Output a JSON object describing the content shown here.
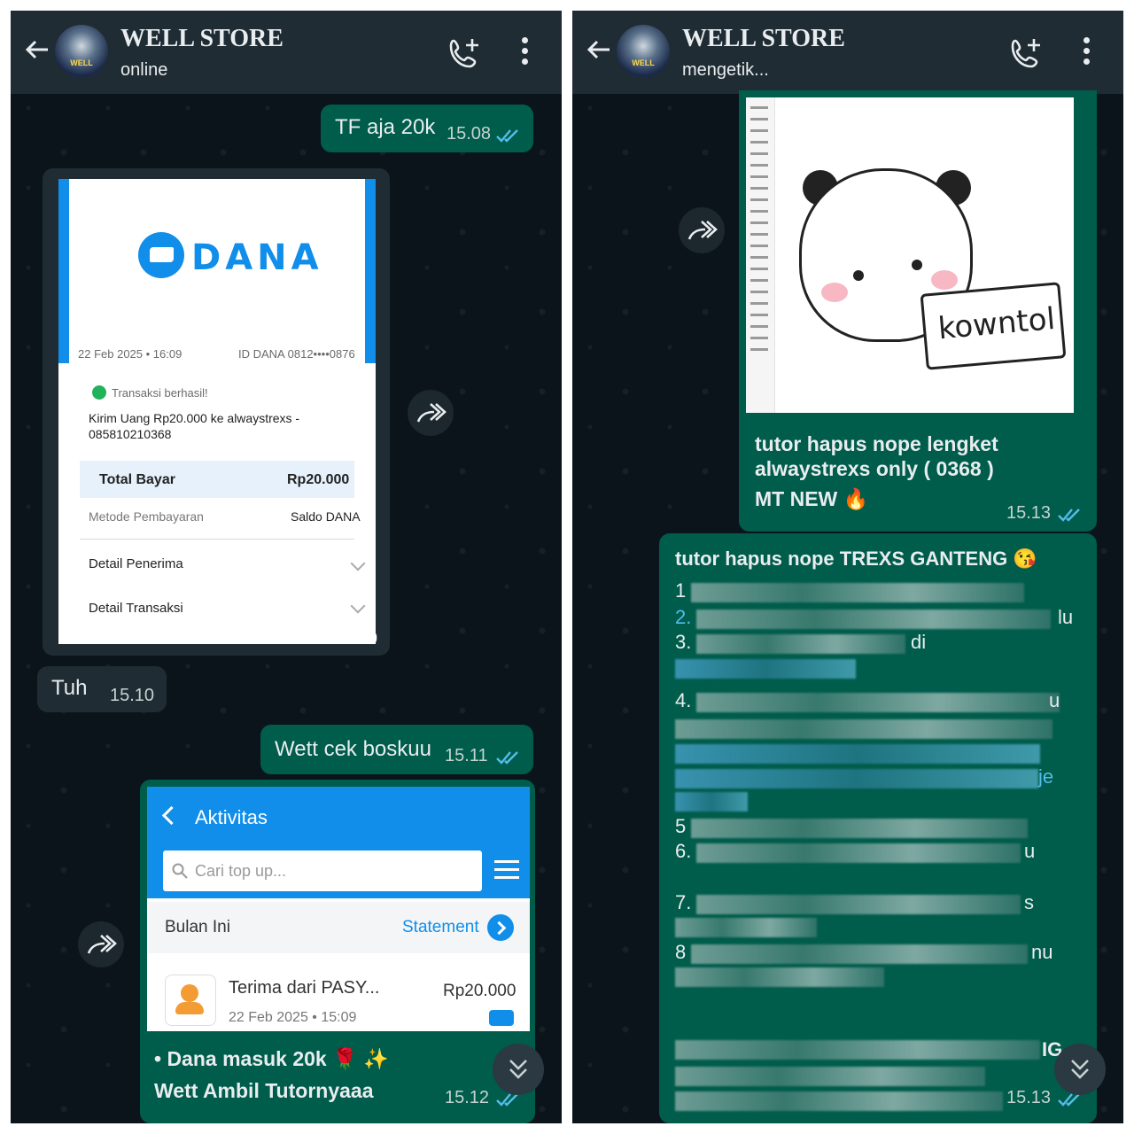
{
  "left": {
    "header": {
      "title": "WELL STORE",
      "status": "online",
      "avatar_text": "WELL"
    },
    "messages": {
      "m1": {
        "text": "TF aja 20k",
        "time": "15.08"
      },
      "m2": {
        "time": "15.10"
      },
      "m3": {
        "text": "Tuh",
        "time": "15.10"
      },
      "m4": {
        "text": "Wett cek boskuu",
        "time": "15.11"
      },
      "m5": {
        "line1": "• Dana masuk 20k 🌹 ✨",
        "line2": "Wett Ambil Tutornyaaa",
        "time": "15.12"
      }
    },
    "receipt": {
      "brand": "DANA",
      "date": "22 Feb 2025 • 16:09",
      "dana_id": "ID DANA 0812••••0876",
      "status": "Transaksi berhasil!",
      "desc_line1": "Kirim Uang Rp20.000 ke alwaystrexs -",
      "desc_line2": "085810210368",
      "total_label": "Total Bayar",
      "total_value": "Rp20.000",
      "method_label": "Metode Pembayaran",
      "method_value": "Saldo DANA",
      "recipient_detail": "Detail Penerima",
      "transaction_detail": "Detail Transaksi"
    },
    "activity": {
      "title": "Aktivitas",
      "search_placeholder": "Cari top up...",
      "month": "Bulan Ini",
      "statement": "Statement",
      "item_name": "Terima dari PASY...",
      "item_date": "22 Feb 2025 • 15:09",
      "item_amount": "Rp20.000"
    }
  },
  "right": {
    "header": {
      "title": "WELL STORE",
      "status": "mengetik...",
      "avatar_text": "WELL"
    },
    "sticker_sign": "kowntol",
    "messages": {
      "m1": {
        "line1": "tutor hapus nope lengket",
        "line2": "alwaystrexs only ( 0368 )",
        "line3": "MT NEW 🔥",
        "time": "15.13"
      },
      "m2": {
        "title": "tutor hapus nope TREXS GANTENG 😘",
        "time": "15.13",
        "nums": [
          "1",
          "2.",
          "3.",
          "4.",
          "5",
          "6.",
          "7.",
          "8"
        ],
        "fragments": {
          "a": "lu",
          "b": "di",
          "c": "u",
          "d": "je",
          "e": "u",
          "f": "s",
          "g": "nu",
          "h": "IG"
        }
      }
    }
  },
  "colors": {
    "bg": "#0b141a",
    "header": "#1f2c34",
    "out_bubble": "#005c4b",
    "in_bubble": "#202c33",
    "dana_blue": "#118eea",
    "tick": "#53bdeb"
  }
}
